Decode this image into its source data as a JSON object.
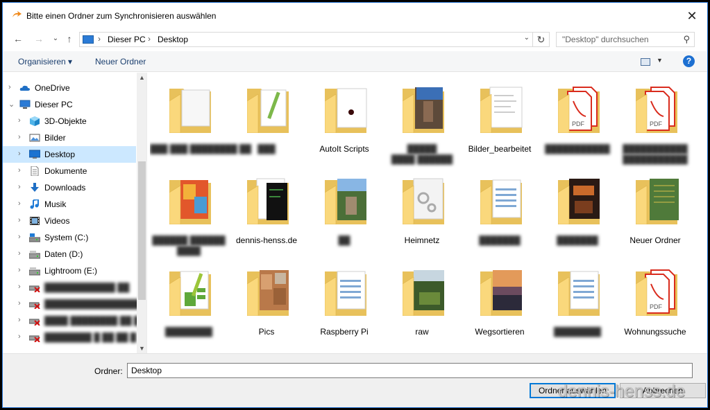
{
  "window": {
    "title": "Bitte einen Ordner zum Synchronisieren auswählen",
    "close": "✕"
  },
  "nav": {
    "back": "←",
    "forward": "→",
    "recent": "⌄",
    "up": "↑",
    "breadcrumb": [
      "Dieser PC",
      "Desktop"
    ],
    "refresh": "↻",
    "search_placeholder": "\"Desktop\" durchsuchen"
  },
  "toolbar": {
    "organize": "Organisieren ▾",
    "new_folder": "Neuer Ordner",
    "help": "?"
  },
  "tree": [
    {
      "label": "OneDrive",
      "icon": "cloud-icon",
      "level": 0,
      "chev": "›"
    },
    {
      "label": "Dieser PC",
      "icon": "computer-icon",
      "level": 0,
      "chev": "⌄"
    },
    {
      "label": "3D-Objekte",
      "icon": "cube-icon",
      "level": 1,
      "chev": "›"
    },
    {
      "label": "Bilder",
      "icon": "pictures-icon",
      "level": 1,
      "chev": "›"
    },
    {
      "label": "Desktop",
      "icon": "desktop-icon",
      "level": 1,
      "chev": "›",
      "selected": true
    },
    {
      "label": "Dokumente",
      "icon": "documents-icon",
      "level": 1,
      "chev": "›"
    },
    {
      "label": "Downloads",
      "icon": "download-icon",
      "level": 1,
      "chev": "›"
    },
    {
      "label": "Musik",
      "icon": "music-icon",
      "level": 1,
      "chev": "›"
    },
    {
      "label": "Videos",
      "icon": "video-icon",
      "level": 1,
      "chev": "›"
    },
    {
      "label": "System (C:)",
      "icon": "system-drive-icon",
      "level": 1,
      "chev": "›"
    },
    {
      "label": "Daten (D:)",
      "icon": "drive-icon",
      "level": 1,
      "chev": "›"
    },
    {
      "label": "Lightroom (E:)",
      "icon": "drive-icon",
      "level": 1,
      "chev": "›"
    },
    {
      "label": "████████████ ██",
      "icon": "network-drive-disconnected-icon",
      "level": 1,
      "chev": "›",
      "blurred": true
    },
    {
      "label": "█████████████████ (",
      "icon": "network-drive-disconnected-icon",
      "level": 1,
      "chev": "›",
      "blurred": true
    },
    {
      "label": "████ ████████ ██ █ (",
      "icon": "network-drive-disconnected-icon",
      "level": 1,
      "chev": "›",
      "blurred": true
    },
    {
      "label": "████████ █ ██ ██ █ ",
      "icon": "network-drive-disconnected-icon",
      "level": 1,
      "chev": "›",
      "blurred": true
    }
  ],
  "items": [
    {
      "name": "███ ███ ████████ ██",
      "line2": "",
      "kind": "folder-doc",
      "blurred": true
    },
    {
      "name": "███",
      "line2": "",
      "kind": "folder-pencil",
      "blurred": true
    },
    {
      "name": "AutoIt Scripts",
      "line2": "",
      "kind": "folder-dot"
    },
    {
      "name": "█████",
      "line2": "████ ██████",
      "kind": "folder-photo",
      "blurred": true
    },
    {
      "name": "Bilder_bearbeitet",
      "line2": "",
      "kind": "folder-doc-text"
    },
    {
      "name": "███████████",
      "line2": "",
      "kind": "folder-pdf",
      "blurred": true
    },
    {
      "name": "███████████",
      "line2": "███████████",
      "kind": "folder-pdf",
      "blurred": true
    },
    {
      "name": "██████ ██████",
      "line2": "████",
      "kind": "folder-colorful",
      "blurred": true
    },
    {
      "name": "dennis-henss.de",
      "line2": "",
      "kind": "folder-dark"
    },
    {
      "name": "██",
      "line2": "",
      "kind": "folder-photo-sky",
      "blurred": true
    },
    {
      "name": "Heimnetz",
      "line2": "",
      "kind": "folder-gears"
    },
    {
      "name": "███████",
      "line2": "",
      "kind": "folder-list",
      "blurred": true
    },
    {
      "name": "███████",
      "line2": "",
      "kind": "folder-stage",
      "blurred": true
    },
    {
      "name": "Neuer Ordner",
      "line2": "",
      "kind": "folder-green-doc"
    },
    {
      "name": "████████",
      "line2": "",
      "kind": "folder-pencil-green",
      "blurred": true
    },
    {
      "name": "Pics",
      "line2": "",
      "kind": "folder-pics"
    },
    {
      "name": "Raspberry Pi",
      "line2": "",
      "kind": "folder-list"
    },
    {
      "name": "raw",
      "line2": "",
      "kind": "folder-photo-trees"
    },
    {
      "name": "Wegsortieren",
      "line2": "",
      "kind": "folder-sunset"
    },
    {
      "name": "████████",
      "line2": "",
      "kind": "folder-list",
      "blurred": true
    },
    {
      "name": "Wohnungssuche",
      "line2": "",
      "kind": "folder-pdf"
    }
  ],
  "bottom": {
    "folder_label": "Ordner:",
    "folder_value": "Desktop",
    "ok_button": "Ordner auswählen",
    "cancel_button": "Abbrechen",
    "watermark": "dennis-henss.de"
  },
  "colors": {
    "folder_back": "#e8c15b",
    "folder_front": "#fad87c",
    "selection": "#cce8ff",
    "pdf_red": "#d92b1d",
    "accent": "#0078d7"
  }
}
